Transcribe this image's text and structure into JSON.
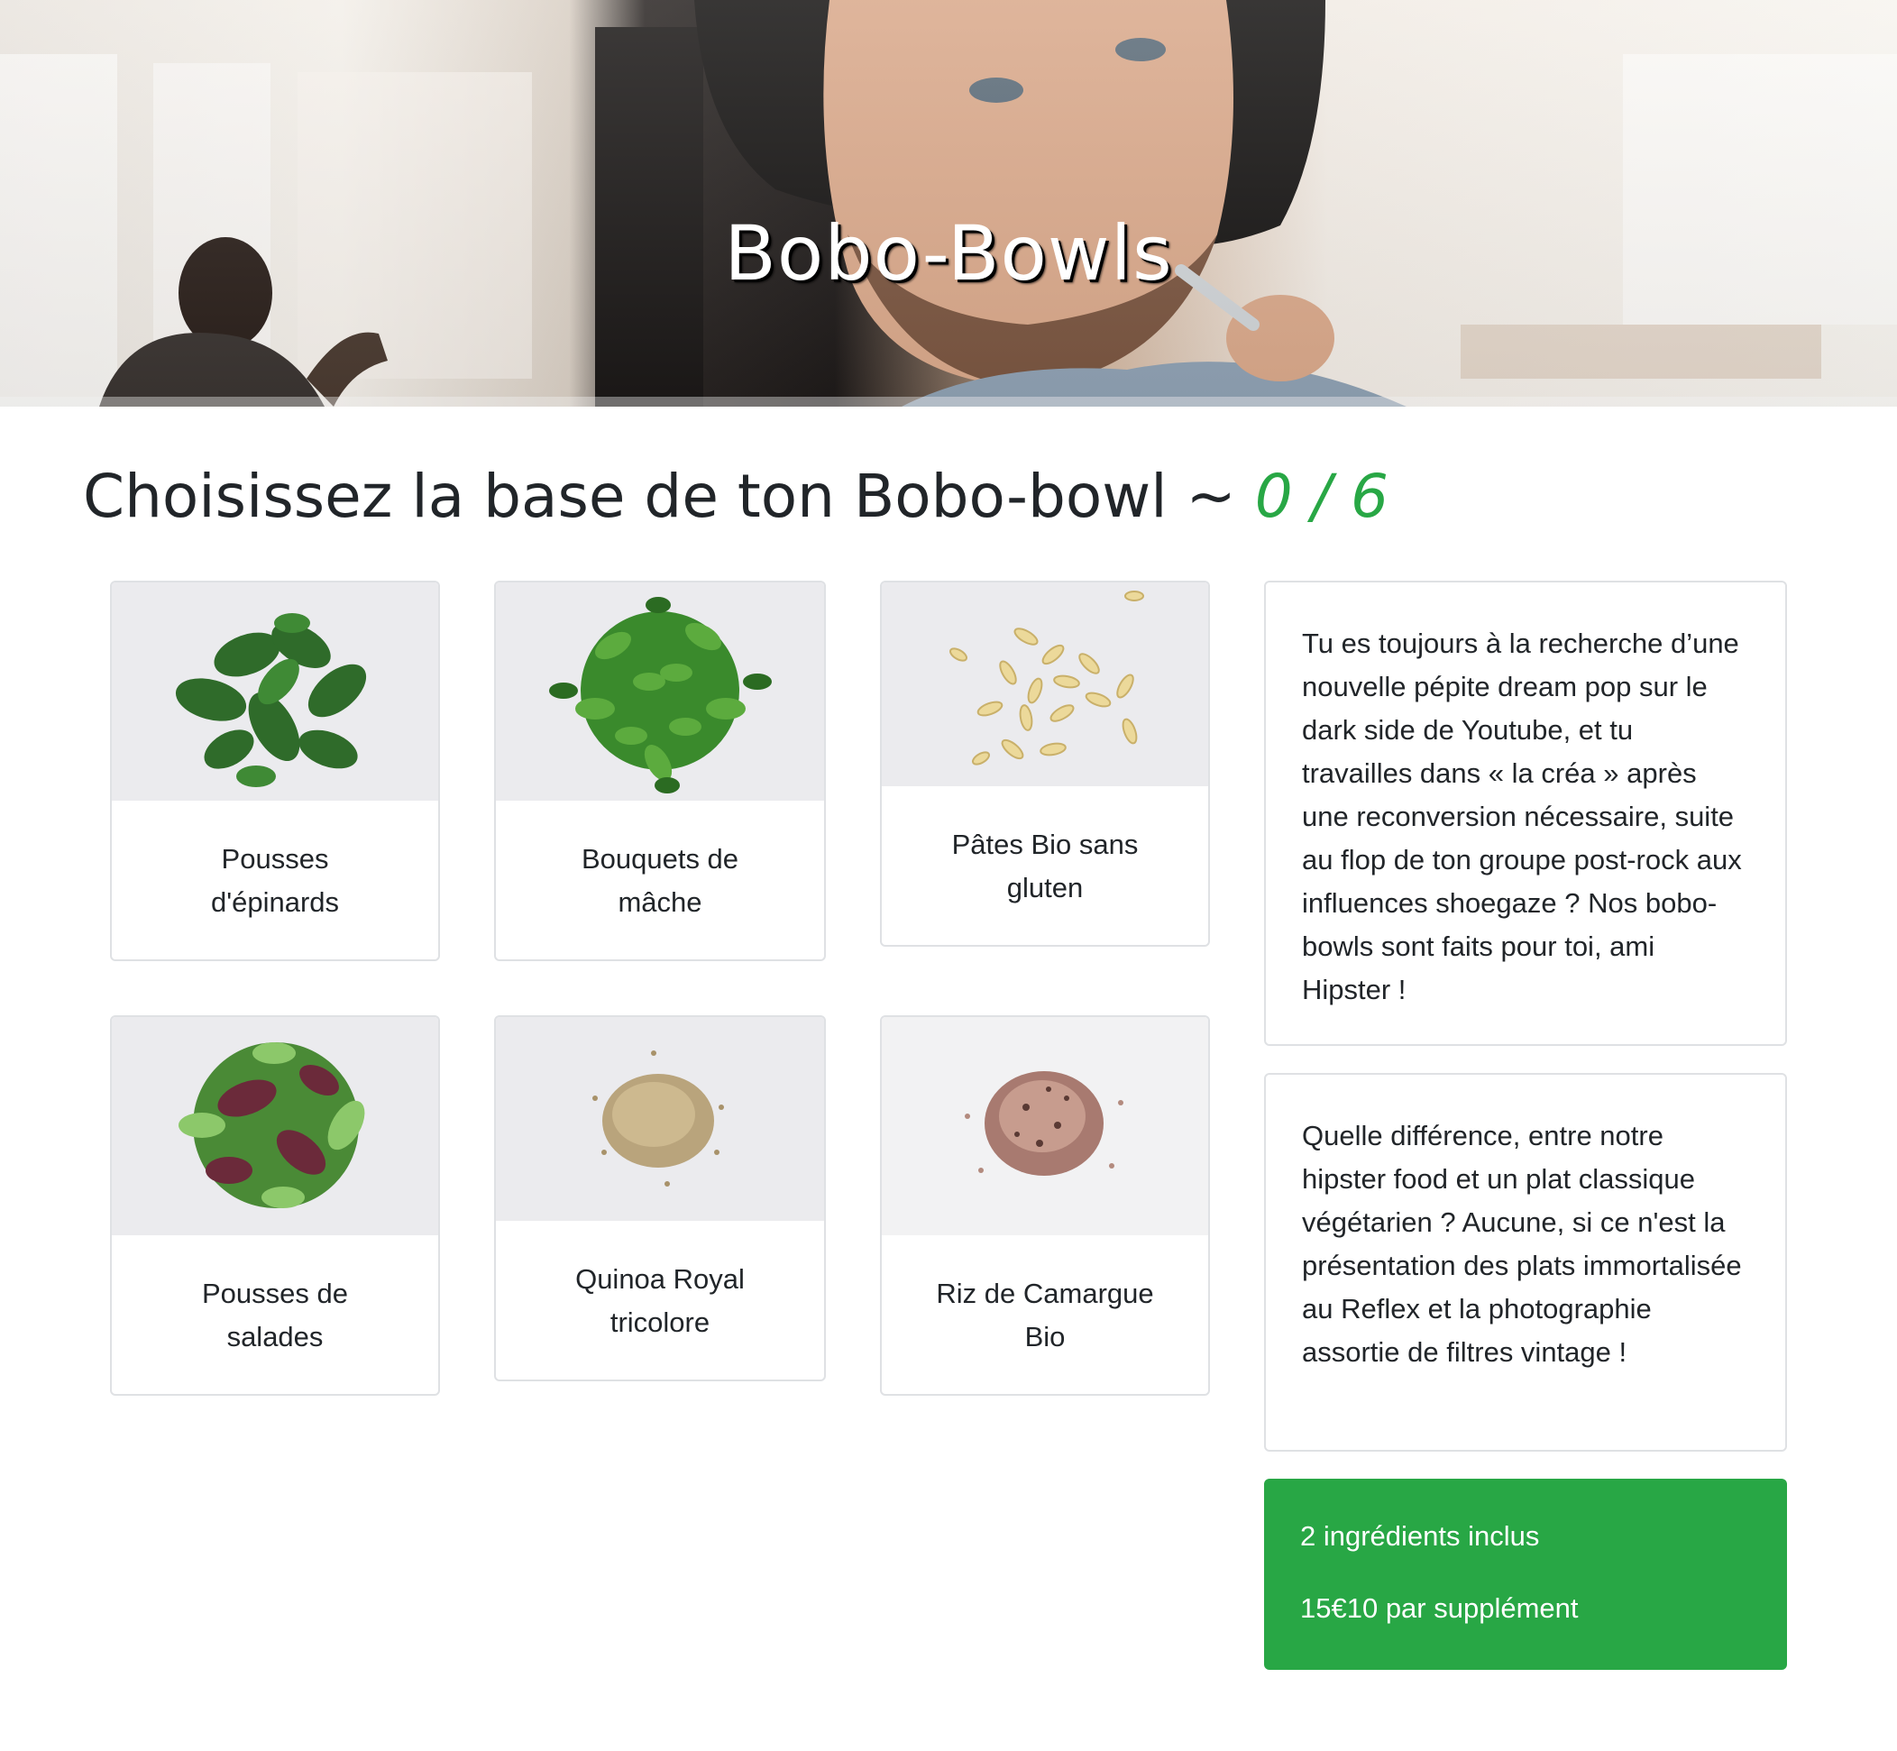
{
  "hero": {
    "title": "Bobo-Bowls"
  },
  "heading": {
    "text": "Choisissez la base de ton Bobo-bowl ~ ",
    "counter": "0 / 6"
  },
  "ingredients": [
    {
      "label": "Pousses d'épinards",
      "icon": "spinach-image"
    },
    {
      "label": "Bouquets de mâche",
      "icon": "lambs-lettuce-image"
    },
    {
      "label": "Pâtes Bio sans gluten",
      "icon": "pasta-image"
    },
    {
      "label": "Pousses de salades",
      "icon": "salad-mix-image"
    },
    {
      "label": "Quinoa Royal tricolore",
      "icon": "quinoa-image"
    },
    {
      "label": "Riz de Camargue Bio",
      "icon": "rice-image"
    }
  ],
  "info": {
    "paragraph1": "Tu es toujours à la recherche d’une nouvelle pépite dream pop sur le dark side de Youtube, et tu travailles dans « la créa » après une reconversion nécessaire, suite au flop de ton groupe post-rock aux influences shoegaze ? Nos bobo-bowls sont faits pour toi, ami Hipster !",
    "paragraph2": "Quelle différence, entre notre hipster food et un plat classique végétarien ? Aucune, si ce n'est la présentation des plats immortalisée au Reflex et la photographie assortie de filtres vintage !"
  },
  "promo": {
    "line1": "2 ingrédients inclus",
    "line2": "15€10 par supplément"
  },
  "colors": {
    "accent": "#28a745",
    "text": "#212529",
    "border": "#dfe1e4"
  }
}
